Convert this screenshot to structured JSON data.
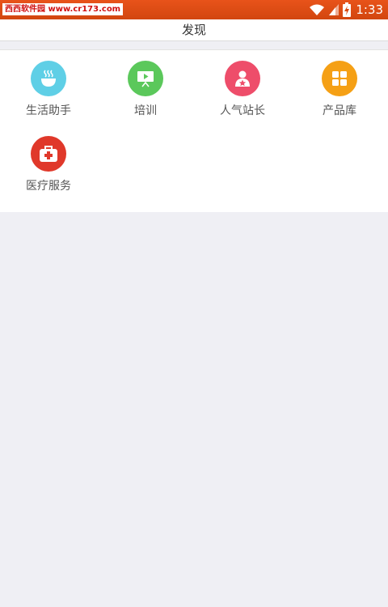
{
  "status_bar": {
    "watermark": "西西软件园 www.cr173.com",
    "time": "1:33",
    "icons": [
      "wifi-icon",
      "signal-icon",
      "battery-charging-icon"
    ]
  },
  "header": {
    "title": "发现"
  },
  "grid": {
    "items": [
      {
        "label": "生活助手",
        "icon": "bowl-icon",
        "color": "#5fcfe6"
      },
      {
        "label": "培训",
        "icon": "presentation-icon",
        "color": "#5bc85b"
      },
      {
        "label": "人气站长",
        "icon": "star-person-icon",
        "color": "#ee4d6a"
      },
      {
        "label": "产品库",
        "icon": "grid-icon",
        "color": "#f5a015"
      },
      {
        "label": "医疗服务",
        "icon": "medical-kit-icon",
        "color": "#e0382a"
      }
    ]
  }
}
